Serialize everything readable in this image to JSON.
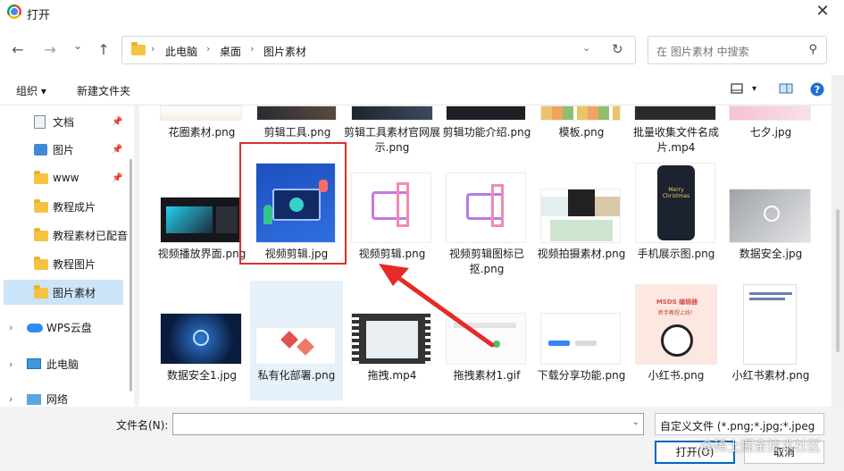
{
  "window": {
    "title": "打开",
    "close_glyph": "✕",
    "app_icon": "chrome-icon"
  },
  "nav": {
    "back": "←",
    "forward": "→",
    "recent": "⌄",
    "up": "↑"
  },
  "address": {
    "segments": [
      "此电脑",
      "桌面",
      "图片素材"
    ],
    "separator": "›",
    "dropdown": "⌄",
    "refresh": "↻"
  },
  "search": {
    "placeholder": "在 图片素材 中搜索",
    "icon": "⚲"
  },
  "toolbar": {
    "organize": "组织 ▾",
    "new_folder": "新建文件夹",
    "view": "▾",
    "help": "?"
  },
  "sidebar": [
    {
      "label": "文档",
      "icon": "document-icon",
      "pinned": true
    },
    {
      "label": "图片",
      "icon": "pictures-icon",
      "pinned": true
    },
    {
      "label": "www",
      "icon": "folder-icon",
      "pinned": true
    },
    {
      "label": "教程成片",
      "icon": "folder-icon"
    },
    {
      "label": "教程素材已配音",
      "icon": "folder-icon"
    },
    {
      "label": "教程图片",
      "icon": "folder-icon"
    },
    {
      "label": "图片素材",
      "icon": "folder-icon",
      "selected": true
    },
    {
      "label": "WPS云盘",
      "icon": "cloud-icon",
      "expand": "›"
    },
    {
      "label": "此电脑",
      "icon": "pc-icon",
      "expand": "›"
    },
    {
      "label": "网络",
      "icon": "network-icon",
      "expand": "›"
    }
  ],
  "files_row1": [
    {
      "name": "花圈素材.png"
    },
    {
      "name": "剪辑工具.png"
    },
    {
      "name": "剪辑工具素材官网展示.png"
    },
    {
      "name": "剪辑功能介绍.png"
    },
    {
      "name": "模板.png"
    },
    {
      "name": "批量收集文件名成片.mp4"
    },
    {
      "name": "七夕.jpg"
    }
  ],
  "files_row2": [
    {
      "name": "视频播放界面.png"
    },
    {
      "name": "视频剪辑.jpg"
    },
    {
      "name": "视频剪辑.png"
    },
    {
      "name": "视频剪辑图标已抠.png"
    },
    {
      "name": "视频拍摄素材.png"
    },
    {
      "name": "手机展示图.png"
    },
    {
      "name": "数据安全.jpg"
    }
  ],
  "files_row3": [
    {
      "name": "数据安全1.jpg"
    },
    {
      "name": "私有化部署.png"
    },
    {
      "name": "拖拽.mp4"
    },
    {
      "name": "拖拽素材1.gif"
    },
    {
      "name": "下载分享功能.png"
    },
    {
      "name": "小红书.png"
    },
    {
      "name": "小红书素材.png"
    }
  ],
  "thumb_text": {
    "xhs_title": "MSDS 编辑器",
    "xhs_sub": "新手教程上线！",
    "phone_text": "Merry Christmas"
  },
  "bottom": {
    "filename_label": "文件名(N):",
    "filename_value": "",
    "filetype": "自定义文件 (*.png;*.jpg;*.jpeg",
    "open": "打开(O)",
    "cancel": "取消"
  },
  "watermark": "@稀土掘金技术社区",
  "colors": {
    "accent": "#0067c0",
    "highlight_box": "#d9302c",
    "selection": "#cce4f7"
  }
}
